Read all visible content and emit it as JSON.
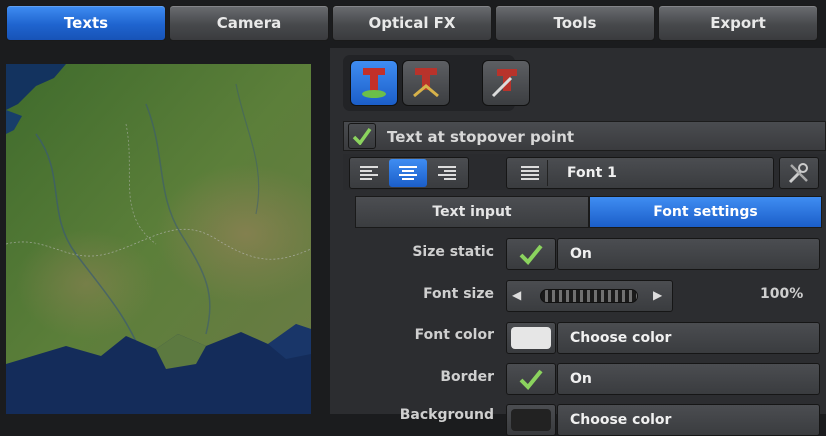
{
  "tabs": [
    {
      "label": "Texts",
      "active": true
    },
    {
      "label": "Camera",
      "active": false
    },
    {
      "label": "Optical FX",
      "active": false
    },
    {
      "label": "Tools",
      "active": false
    },
    {
      "label": "Export",
      "active": false
    }
  ],
  "text_header": {
    "label": "Text at stopover point",
    "checked": true
  },
  "font": {
    "label": "Font 1"
  },
  "subtabs": [
    {
      "label": "Text input",
      "active": false
    },
    {
      "label": "Font settings",
      "active": true
    }
  ],
  "settings": {
    "size_static": {
      "label": "Size static",
      "value": "On",
      "checked": true
    },
    "font_size": {
      "label": "Font size",
      "percent": "100%",
      "level": 1.0
    },
    "font_color": {
      "label": "Font color",
      "value": "Choose color",
      "swatch": "#e6e6e6"
    },
    "border": {
      "label": "Border",
      "value": "On",
      "checked": true
    },
    "background": {
      "label": "Background",
      "value": "Choose color"
    }
  },
  "colors": {
    "accent": "#1f64cf",
    "panel": "#2c2d30",
    "check": "#8bd35e"
  },
  "icons": [
    "text-icon",
    "text-3d-icon",
    "text-edit-icon",
    "align-left-icon",
    "align-center-icon",
    "align-right-icon",
    "list-icon",
    "tools-icon"
  ]
}
